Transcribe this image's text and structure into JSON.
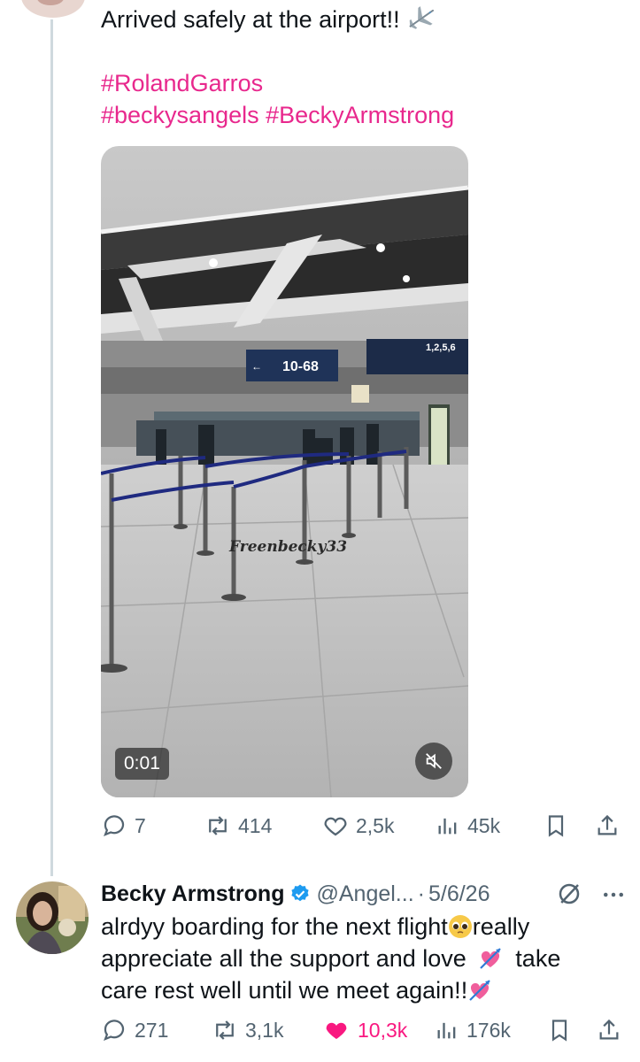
{
  "original_tweet": {
    "text_line1": "Arrived safely at the airport!!",
    "hashtag_line1": "#RolandGarros",
    "hashtag_line2": "#beckysangels #BeckyArmstrong",
    "video": {
      "timer": "0:01",
      "watermark": "Freenbecky33",
      "sign_gate": "10-68",
      "sign_board": "1,2,5,6"
    },
    "stats": {
      "replies": "7",
      "reposts": "414",
      "likes": "2,5k",
      "views": "45k"
    }
  },
  "reply_tweet": {
    "author_name": "Becky Armstrong",
    "handle": "@Angel...",
    "separator": "·",
    "date": "5/6/26",
    "text_line1": "alrdyy boarding for the next flight",
    "text_line1b": "really",
    "text_line2a": "appreciate all the support and love",
    "text_line2b": "take",
    "text_line3": "care rest well until we meet again!!",
    "stats": {
      "replies": "271",
      "reposts": "3,1k",
      "likes": "10,3k",
      "views": "176k",
      "liked": true
    }
  },
  "colors": {
    "hashtag": "#e8288d",
    "like_active": "#f91880",
    "muted_text": "#536471",
    "verified": "#1d9bf0"
  },
  "icons": [
    "airplane-icon",
    "reply-icon",
    "repost-icon",
    "heart-icon",
    "views-icon",
    "bookmark-icon",
    "share-icon",
    "verified-badge-icon",
    "grok-icon",
    "more-icon",
    "mute-icon"
  ]
}
